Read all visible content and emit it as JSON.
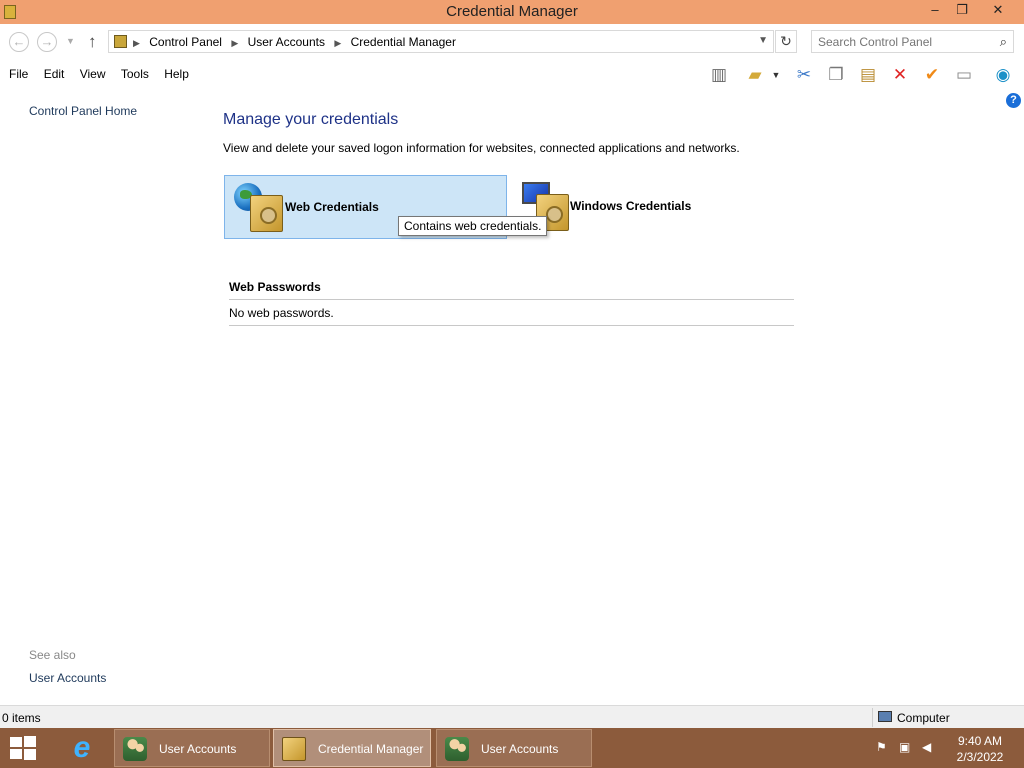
{
  "window": {
    "title": "Credential Manager",
    "minimize_glyph": "–",
    "restore_glyph": "❐",
    "close_glyph": "✕"
  },
  "address": {
    "back_glyph": "←",
    "forward_glyph": "→",
    "up_glyph": "↑",
    "breadcrumbs": [
      "Control Panel",
      "User Accounts",
      "Credential Manager"
    ],
    "refresh_glyph": "↻",
    "search_placeholder": "Search Control Panel"
  },
  "menu": {
    "items": [
      "File",
      "Edit",
      "View",
      "Tools",
      "Help"
    ]
  },
  "toolbar": {
    "icons": [
      "layout-icon",
      "folder-properties-icon",
      "dropdown-icon",
      "cut-icon",
      "copy-icon",
      "paste-icon",
      "delete-icon",
      "checkmark-icon",
      "properties-icon",
      "globe-icon"
    ]
  },
  "sidebar": {
    "home_link": "Control Panel Home",
    "see_also": "See also",
    "see_also_link": "User Accounts"
  },
  "main": {
    "heading": "Manage your credentials",
    "description": "View and delete your saved logon information for websites, connected applications and networks.",
    "web_credentials_label": "Web Credentials",
    "windows_credentials_label": "Windows Credentials",
    "tooltip": "Contains web credentials.",
    "section_title": "Web Passwords",
    "empty_message": "No web passwords."
  },
  "statusbar": {
    "item_count": "0 items",
    "location": "Computer"
  },
  "taskbar": {
    "tasks": [
      {
        "label": "User Accounts",
        "active": false
      },
      {
        "label": "Credential Manager",
        "active": true
      },
      {
        "label": "User Accounts",
        "active": false
      }
    ],
    "time": "9:40 AM",
    "date": "2/3/2022"
  },
  "colors": {
    "titlebar": "#f0a070",
    "taskbar": "#8c5b3c",
    "link": "#1e395b",
    "heading": "#1e3287",
    "selection": "#cde5f7"
  }
}
